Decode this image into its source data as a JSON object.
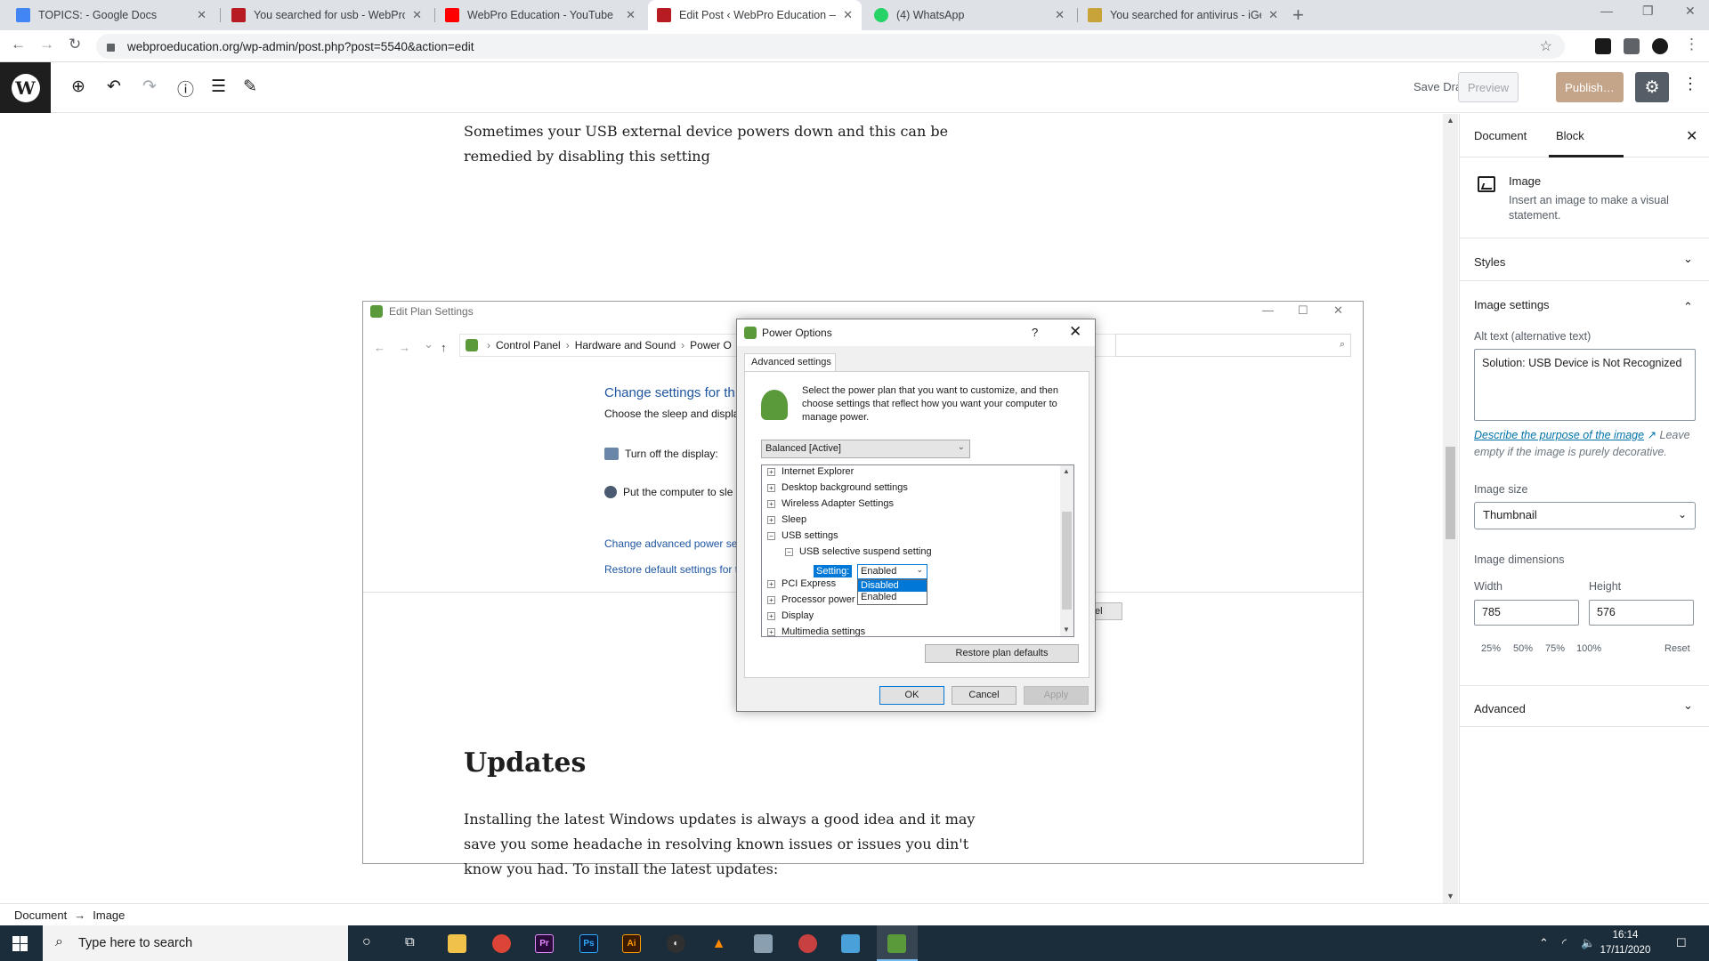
{
  "browser": {
    "tabs": [
      {
        "title": "TOPICS: - Google Docs",
        "favicon_color": "#4285f4"
      },
      {
        "title": "You searched for usb - WebPro E",
        "favicon_color": "#b81c23"
      },
      {
        "title": "WebPro Education - YouTube",
        "favicon_color": "#ff0000"
      },
      {
        "title": "Edit Post ‹ WebPro Education —",
        "favicon_color": "#b81c23"
      },
      {
        "title": "(4) WhatsApp",
        "favicon_color": "#25d366"
      },
      {
        "title": "You searched for antivirus - iGet",
        "favicon_color": "#c7a33a"
      }
    ],
    "active_tab_index": 3,
    "url": "webproeducation.org/wp-admin/post.php?post=5540&action=edit",
    "icons": {
      "back": "←",
      "forward": "→",
      "reload": "↻",
      "star": "☆",
      "new_tab": "+",
      "minimize": "—",
      "maximize": "❐",
      "close": "✕",
      "menu": "⋮"
    }
  },
  "wp_toolbar": {
    "logo": "W",
    "icons": {
      "add": "⊕",
      "undo": "↶",
      "redo": "↷",
      "info": "ⓘ",
      "outline": "☰",
      "edit": "✎",
      "settings": "⚙",
      "more": "⋮"
    },
    "save_draft": "Save Draft",
    "preview": "Preview",
    "publish": "Publish…"
  },
  "content": {
    "intro_paragraph": "Sometimes your USB external device powers down and this can be remedied by disabling this setting",
    "heading": "Updates",
    "body_paragraph": "Installing the latest Windows updates is always a good idea and it may save you some headache in resolving known issues or issues you din't know you had. To install the latest updates:"
  },
  "image_shot": {
    "window_title": "Edit Plan Settings",
    "window_controls": {
      "min": "—",
      "max": "☐",
      "close": "✕"
    },
    "nav_arrows": {
      "back": "←",
      "forward": "→",
      "down": "⌄",
      "up": "↑"
    },
    "breadcrumb": [
      "Control Panel",
      "Hardware and Sound",
      "Power O"
    ],
    "search_icon": "⌕",
    "heading": "Change settings for th",
    "subheading": "Choose the sleep and displa",
    "row_display": "Turn off the display:",
    "row_sleep": "Put the computer to sle",
    "link_advanced": "Change advanced power set",
    "link_restore": "Restore default settings for t",
    "partial_button": "el",
    "dialog": {
      "title": "Power Options",
      "help": "?",
      "close": "✕",
      "tab": "Advanced settings",
      "description": "Select the power plan that you want to customize, and then choose settings that reflect how you want your computer to manage power.",
      "plan": "Balanced [Active]",
      "tree": [
        {
          "label": "Internet Explorer",
          "exp": "+"
        },
        {
          "label": "Desktop background settings",
          "exp": "+"
        },
        {
          "label": "Wireless Adapter Settings",
          "exp": "+"
        },
        {
          "label": "Sleep",
          "exp": "+"
        },
        {
          "label": "USB settings",
          "exp": "−"
        },
        {
          "label": "USB selective suspend setting",
          "exp": "−"
        },
        {
          "label": "PCI Express",
          "exp": "+"
        },
        {
          "label": "Processor power management",
          "exp": "+"
        },
        {
          "label": "Display",
          "exp": "+"
        },
        {
          "label": "Multimedia settings",
          "exp": "+"
        }
      ],
      "setting_label": "Setting:",
      "setting_value": "Enabled",
      "dropdown_options": [
        "Disabled",
        "Enabled"
      ],
      "dropdown_selected": "Disabled",
      "restore_button": "Restore plan defaults",
      "ok": "OK",
      "cancel": "Cancel",
      "apply": "Apply"
    }
  },
  "sidebar": {
    "tab_document": "Document",
    "tab_block": "Block",
    "active_tab": "Block",
    "close": "✕",
    "block_name": "Image",
    "block_description": "Insert an image to make a visual statement.",
    "styles": "Styles",
    "image_settings": "Image settings",
    "alt_label": "Alt text (alternative text)",
    "alt_value": "Solution: USB Device is Not Recognized",
    "alt_help_link": "Describe the purpose of the image",
    "alt_help_rest": "Leave empty if the image is purely decorative.",
    "image_size_label": "Image size",
    "image_size_value": "Thumbnail",
    "dimensions_label": "Image dimensions",
    "width_label": "Width",
    "height_label": "Height",
    "width_value": "785",
    "height_value": "576",
    "pct_options": [
      "25%",
      "50%",
      "75%",
      "100%"
    ],
    "reset": "Reset",
    "advanced": "Advanced",
    "chevron_down": "⌄",
    "chevron_up": "⌃"
  },
  "footer": {
    "crumb_document": "Document",
    "arrow": "→",
    "crumb_image": "Image"
  },
  "taskbar": {
    "search_placeholder": "Type here to search",
    "apps": [
      {
        "name": "cortana",
        "label": "○",
        "color": "#1b2c3a"
      },
      {
        "name": "task-view",
        "label": "⧉",
        "color": "#1b2c3a"
      },
      {
        "name": "file-explorer",
        "label": "",
        "color": "#f0c24a"
      },
      {
        "name": "chrome",
        "label": "",
        "color": "#db4437"
      },
      {
        "name": "premiere",
        "label": "Pr",
        "color": "#2a0a3a"
      },
      {
        "name": "photoshop",
        "label": "Ps",
        "color": "#0a1e3a"
      },
      {
        "name": "illustrator",
        "label": "Ai",
        "color": "#3a1a00"
      },
      {
        "name": "obs",
        "label": "◐",
        "color": "#303030"
      },
      {
        "name": "vlc",
        "label": "▲",
        "color": "#1b2c3a"
      },
      {
        "name": "app-9",
        "label": "",
        "color": "#8aa0b0"
      },
      {
        "name": "app-10",
        "label": "",
        "color": "#c84040"
      },
      {
        "name": "app-11",
        "label": "",
        "color": "#4aa0d8"
      },
      {
        "name": "power-options",
        "label": "",
        "color": "#5a9a3a"
      }
    ],
    "tray_icons": {
      "chevron": "⌃",
      "network": "◜",
      "volume": "🔈"
    },
    "time": "16:14",
    "date": "17/11/2020",
    "notifications": "☐"
  }
}
